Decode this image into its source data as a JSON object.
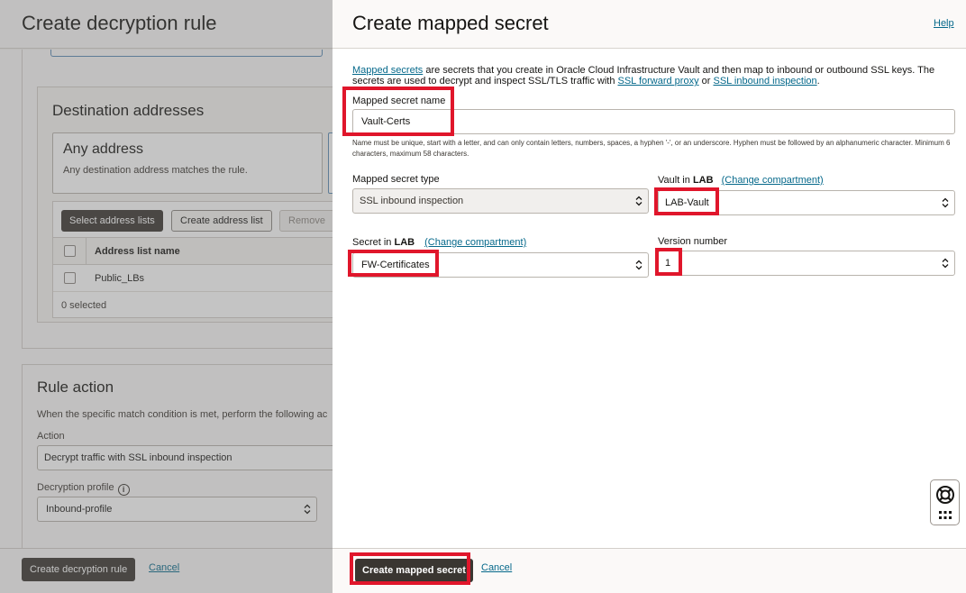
{
  "background": {
    "title": "Create decryption rule",
    "destination": {
      "title": "Destination addresses",
      "any_title": "Any address",
      "any_desc": "Any destination address matches the rule.",
      "toolbar": {
        "select_label": "Select address lists",
        "create_label": "Create address list",
        "remove_label": "Remove"
      },
      "column_header": "Address list name",
      "rows": [
        "Public_LBs"
      ],
      "selected_count": "0 selected"
    },
    "rule_action": {
      "title": "Rule action",
      "desc": "When the specific match condition is met, perform the following ac",
      "action_label": "Action",
      "action_value": "Decrypt traffic with SSL inbound inspection",
      "profile_label": "Decryption profile",
      "profile_value": "Inbound-profile"
    },
    "footer": {
      "create_label": "Create decryption rule",
      "cancel_label": "Cancel"
    }
  },
  "panel": {
    "title": "Create mapped secret",
    "help_label": "Help",
    "intro": {
      "link_mapped": "Mapped secrets",
      "text1": " are secrets that you create in Oracle Cloud Infrastructure Vault and then map to inbound or outbound SSL keys. The secrets are used to decrypt and inspect SSL/TLS traffic with ",
      "link_forward": "SSL forward proxy",
      "text2": " or ",
      "link_inbound": "SSL inbound inspection",
      "text3": "."
    },
    "name": {
      "label": "Mapped secret name",
      "value": "Vault-Certs",
      "hint": "Name must be unique, start with a letter, and can only contain letters, numbers, spaces, a hyphen '-', or an underscore. Hyphen must be followed by an alphanumeric character. Minimum 6 characters, maximum 58 characters."
    },
    "type": {
      "label": "Mapped secret type",
      "value": "SSL inbound inspection"
    },
    "vault": {
      "label_prefix": "Vault in ",
      "compartment": "LAB",
      "change_label": "(Change compartment)",
      "value": "LAB-Vault"
    },
    "secret": {
      "label_prefix": "Secret in ",
      "compartment": "LAB",
      "change_label": "(Change compartment)",
      "value": "FW-Certificates"
    },
    "version": {
      "label": "Version number",
      "value": "1"
    },
    "footer": {
      "create_label": "Create mapped secret",
      "cancel_label": "Cancel"
    }
  },
  "colors": {
    "highlight": "#e0162b",
    "link": "#06698b",
    "primary_button": "#3a3631"
  },
  "icons": [
    "info-icon",
    "chevron-updown-icon",
    "lifebuoy-icon",
    "grid-icon"
  ]
}
